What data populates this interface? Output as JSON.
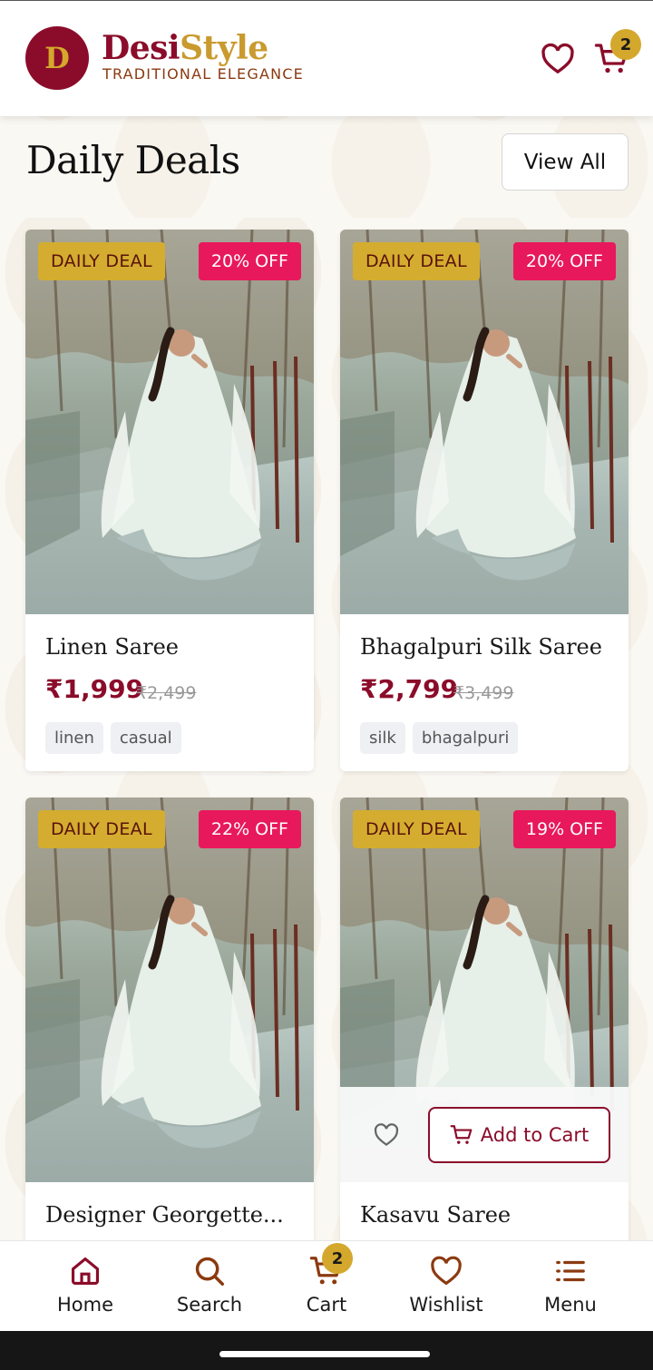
{
  "header": {
    "logo_letter": "D",
    "brand_part1": "Desi",
    "brand_part2": "Style",
    "tagline": "TRADITIONAL ELEGANCE",
    "cart_count": "2"
  },
  "section": {
    "title": "Daily Deals",
    "view_all_label": "View All"
  },
  "products": [
    {
      "badge": "DAILY DEAL",
      "discount": "20% OFF",
      "name": "Linen Saree",
      "price": "₹1,999",
      "original_price": "₹2,499",
      "tags": [
        "linen",
        "casual"
      ]
    },
    {
      "badge": "DAILY DEAL",
      "discount": "20% OFF",
      "name": "Bhagalpuri Silk Saree",
      "price": "₹2,799",
      "original_price": "₹3,499",
      "tags": [
        "silk",
        "bhagalpuri"
      ]
    },
    {
      "badge": "DAILY DEAL",
      "discount": "22% OFF",
      "name": "Designer Georgette...",
      "price": "",
      "original_price": "",
      "tags": []
    },
    {
      "badge": "DAILY DEAL",
      "discount": "19% OFF",
      "name": "Kasavu Saree",
      "price": "",
      "original_price": "",
      "tags": [],
      "add_to_cart_label": "Add to Cart"
    }
  ],
  "bottom_nav": {
    "items": [
      {
        "label": "Home",
        "icon": "home-icon"
      },
      {
        "label": "Search",
        "icon": "search-icon"
      },
      {
        "label": "Cart",
        "icon": "cart-icon"
      },
      {
        "label": "Wishlist",
        "icon": "heart-icon"
      },
      {
        "label": "Menu",
        "icon": "menu-icon"
      }
    ],
    "cart_count": "2"
  },
  "colors": {
    "brand_maroon": "#8b0c2a",
    "brand_gold": "#d4a82c",
    "discount_pink": "#e8185c"
  }
}
